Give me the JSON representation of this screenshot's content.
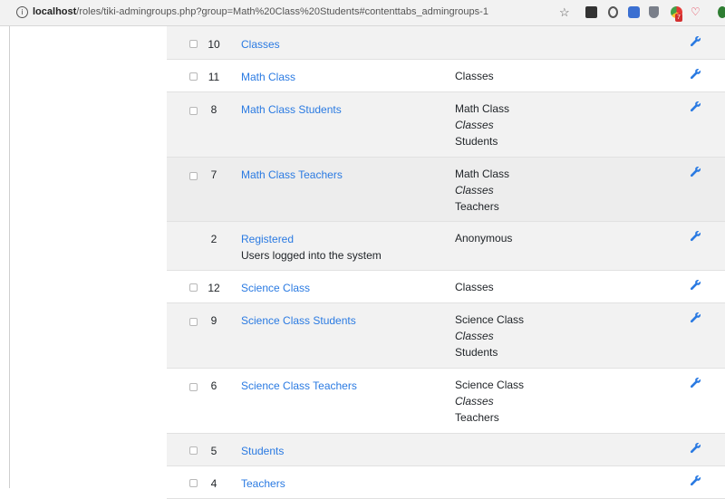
{
  "browser": {
    "url_host": "localhost",
    "url_path": "/roles/tiki-admingroups.php?group=Math%20Class%20Students#contenttabs_admingroups-1",
    "badge_count": "7",
    "colors": {
      "link": "#2a7ae2",
      "row_shade": "#f2f2f2"
    }
  },
  "groups": [
    {
      "id": "10",
      "name": "Classes",
      "includes": [
        "",
        "",
        ""
      ],
      "desc": "",
      "has_checkbox": true
    },
    {
      "id": "11",
      "name": "Math Class",
      "includes": [
        "Classes",
        "",
        ""
      ],
      "desc": "",
      "has_checkbox": true
    },
    {
      "id": "8",
      "name": "Math Class Students",
      "includes": [
        "Math Class",
        "Classes",
        "Students"
      ],
      "desc": "",
      "has_checkbox": true
    },
    {
      "id": "7",
      "name": "Math Class Teachers",
      "includes": [
        "Math Class",
        "Classes",
        "Teachers"
      ],
      "desc": "",
      "has_checkbox": true
    },
    {
      "id": "2",
      "name": "Registered",
      "includes": [
        "Anonymous",
        "",
        ""
      ],
      "desc": "Users logged into the system",
      "has_checkbox": false
    },
    {
      "id": "12",
      "name": "Science Class",
      "includes": [
        "Classes",
        "",
        ""
      ],
      "desc": "",
      "has_checkbox": true
    },
    {
      "id": "9",
      "name": "Science Class Students",
      "includes": [
        "Science Class",
        "Classes",
        "Students"
      ],
      "desc": "",
      "has_checkbox": true
    },
    {
      "id": "6",
      "name": "Science Class Teachers",
      "includes": [
        "Science Class",
        "Classes",
        "Teachers"
      ],
      "desc": "",
      "has_checkbox": true
    },
    {
      "id": "5",
      "name": "Students",
      "includes": [
        "",
        "",
        ""
      ],
      "desc": "",
      "has_checkbox": true
    },
    {
      "id": "4",
      "name": "Teachers",
      "includes": [
        "",
        "",
        ""
      ],
      "desc": "",
      "has_checkbox": true
    }
  ]
}
